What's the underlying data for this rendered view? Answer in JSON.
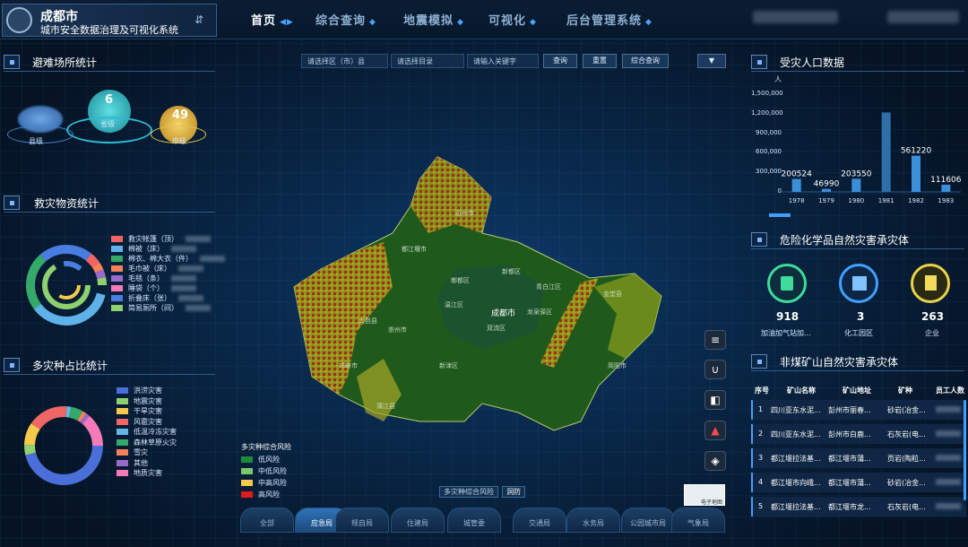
{
  "header": {
    "city": "成都市",
    "system": "城市安全数据治理及可视化系统",
    "nav": [
      "首页",
      "综合查询",
      "地震模拟",
      "可视化",
      "后台管理系统"
    ]
  },
  "shelter": {
    "title": "避难场所统计",
    "levels": [
      {
        "value": "",
        "label": "县级"
      },
      {
        "value": "6",
        "label": "省级"
      },
      {
        "value": "49",
        "label": "市级"
      }
    ]
  },
  "relief": {
    "title": "救灾物资统计",
    "items": [
      {
        "label": "救灾帐篷（顶）",
        "color": "#f06666"
      },
      {
        "label": "棉被（床）",
        "color": "#5fb2e8"
      },
      {
        "label": "棉衣、棉大衣（件）",
        "color": "#35a96a"
      },
      {
        "label": "毛巾被（床）",
        "color": "#f4825a"
      },
      {
        "label": "毛毯（条）",
        "color": "#9a6acb"
      },
      {
        "label": "睡袋（个）",
        "color": "#f57ab8"
      },
      {
        "label": "折叠床（张）",
        "color": "#4a7de0"
      },
      {
        "label": "简易厕所（间）",
        "color": "#8ed16e"
      }
    ]
  },
  "hazards": {
    "title": "多灾种占比统计",
    "items": [
      {
        "label": "洪涝灾害",
        "color": "#4a6fd8"
      },
      {
        "label": "地震灾害",
        "color": "#8ed16e"
      },
      {
        "label": "干旱灾害",
        "color": "#f5c94a"
      },
      {
        "label": "风雹灾害",
        "color": "#f06666"
      },
      {
        "label": "低温冷冻灾害",
        "color": "#63b8e8"
      },
      {
        "label": "森林草原火灾",
        "color": "#35a96a"
      },
      {
        "label": "雪灾",
        "color": "#f4825a"
      },
      {
        "label": "其他",
        "color": "#9a6acb"
      },
      {
        "label": "地质灾害",
        "color": "#f57ab8"
      }
    ]
  },
  "search": {
    "district": "请选择区（市）县",
    "catalog": "请选择目录",
    "keyword": "请输入关键字",
    "query": "查询",
    "reset": "重置",
    "combined": "综合查询"
  },
  "map": {
    "legend_title": "多灾种综合风险",
    "legend": [
      {
        "label": "低风险",
        "color": "#1d8c3a"
      },
      {
        "label": "中低风险",
        "color": "#7cc86a"
      },
      {
        "label": "中高风险",
        "color": "#f5c94a"
      },
      {
        "label": "高风险",
        "color": "#e01b1b"
      }
    ],
    "chips": [
      "多灾种综合风险",
      "洞防"
    ],
    "basemap": "电子地图",
    "labels": [
      "新都区",
      "郫都区",
      "温江区",
      "双流区",
      "成都市",
      "龙泉驿区",
      "青白江区",
      "金堂县",
      "崇州市",
      "都江堰市",
      "彭州市",
      "大邑县",
      "邛崃市",
      "蒲江县",
      "新津区",
      "简阳市"
    ]
  },
  "tabs": [
    "全部",
    "应急局",
    "规自局",
    "住建局",
    "城管委",
    "交通局",
    "水务局",
    "公园城市局",
    "气象局"
  ],
  "population": {
    "title": "受灾人口数据",
    "unit": "人",
    "yticks": [
      "1,500,000",
      "1,200,000",
      "900,000",
      "600,000",
      "300,000",
      "0"
    ],
    "chart_data": {
      "type": "bar",
      "categories": [
        "1978",
        "1979",
        "1980",
        "1981",
        "1982",
        "1983"
      ],
      "values": [
        200524,
        46990,
        203550,
        1230000,
        561220,
        111606
      ],
      "labels": [
        "200524",
        "46990",
        "203550",
        "",
        "561220",
        "111606"
      ],
      "ylim": [
        0,
        1500000
      ],
      "ylabel": "人"
    }
  },
  "hazchem": {
    "title": "危险化学品自然灾害承灾体",
    "items": [
      {
        "value": "918",
        "label": "加油加气站加...",
        "color": "#3ddc9a"
      },
      {
        "value": "3",
        "label": "化工园区",
        "color": "#3fa0ff"
      },
      {
        "value": "263",
        "label": "企业",
        "color": "#e8d24a"
      }
    ]
  },
  "mines": {
    "title": "非煤矿山自然灾害承灾体",
    "headers": [
      "序号",
      "矿山名称",
      "矿山地址",
      "矿种",
      "员工人数"
    ],
    "rows": [
      [
        "1",
        "四川亚东水泥...",
        "彭州市丽春...",
        "砂岩(冶金..."
      ],
      [
        "2",
        "四川亚东水泥...",
        "彭州市白鹿...",
        "石灰岩(电..."
      ],
      [
        "3",
        "都江堰拉法基...",
        "都江堰市蒲...",
        "页岩(陶粒..."
      ],
      [
        "4",
        "都江堰市向峨...",
        "都江堰市蒲...",
        "砂岩(冶金..."
      ],
      [
        "5",
        "都江堰拉法基...",
        "都江堰市龙...",
        "石灰岩(电..."
      ]
    ]
  }
}
